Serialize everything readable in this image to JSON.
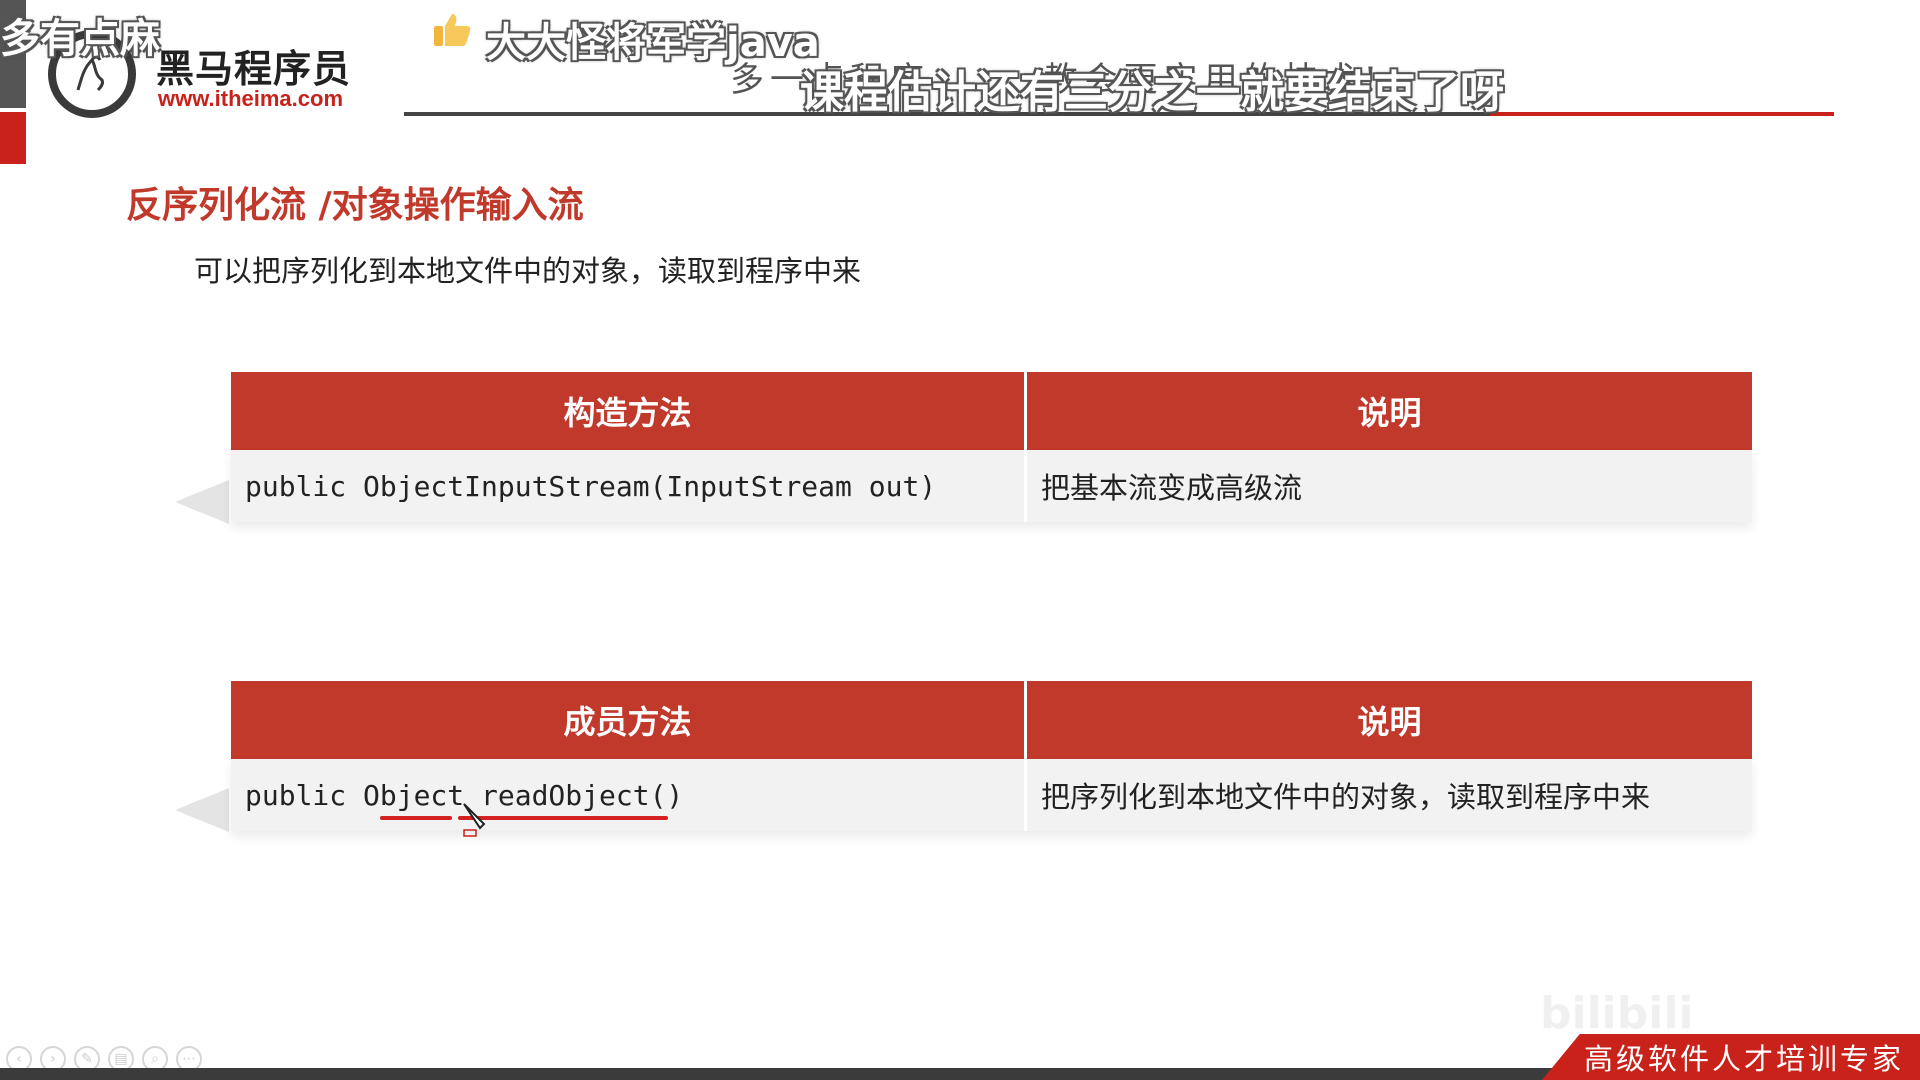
{
  "overlay": {
    "corner_comment": "多有点麻",
    "user_comment": "大大怪将军学java",
    "subtitle": "课程估计还有三分之一就要结束了呀"
  },
  "logo": {
    "name": "黑马程序员",
    "url": "www.itheima.com"
  },
  "header": {
    "slogan": "多一点程序   ……   教会更实用的技术!"
  },
  "slide": {
    "title": "反序列化流 /对象操作输入流",
    "subtitle": "可以把序列化到本地文件中的对象，读取到程序中来"
  },
  "constructor_table": {
    "headers": [
      "构造方法",
      "说明"
    ],
    "rows": [
      {
        "method": "public ObjectInputStream(InputStream out)",
        "desc": "把基本流变成高级流"
      }
    ]
  },
  "member_table": {
    "headers": [
      "成员方法",
      "说明"
    ],
    "rows": [
      {
        "method": "public Object readObject()",
        "desc": "把序列化到本地文件中的对象，读取到程序中来"
      }
    ]
  },
  "footer": {
    "tagline": "高级软件人才培训专家",
    "watermark": "bilibili"
  },
  "colors": {
    "accent_red": "#c0392b",
    "annotation_red": "#d42020",
    "text": "#222222"
  },
  "icons": [
    "thumbs-up-icon",
    "logo-icon",
    "cursor-icon",
    "player-control-icons"
  ]
}
